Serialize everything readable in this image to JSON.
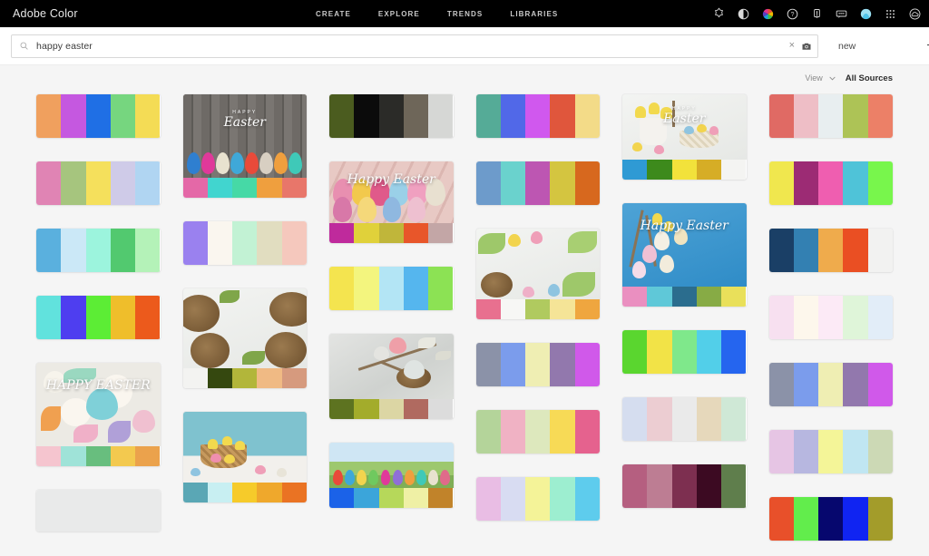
{
  "topbar": {
    "brand": "Adobe Color",
    "nav": [
      {
        "label": "CREATE"
      },
      {
        "label": "EXPLORE"
      },
      {
        "label": "TRENDS"
      },
      {
        "label": "LIBRARIES"
      }
    ],
    "icons": [
      {
        "name": "badge-star-icon"
      },
      {
        "name": "contrast-circle-icon"
      },
      {
        "name": "color-wheel-icon"
      },
      {
        "name": "help-question-icon"
      },
      {
        "name": "notifications-bell-icon"
      },
      {
        "name": "feedback-chat-icon"
      },
      {
        "name": "user-avatar-icon"
      },
      {
        "name": "app-grid-icon"
      },
      {
        "name": "creative-cloud-icon"
      }
    ]
  },
  "search": {
    "value": "happy easter",
    "placeholder": "Search",
    "clear_label": "×",
    "camera_icon": "camera-icon",
    "sort_value": "new",
    "add_label": "+"
  },
  "viewbar": {
    "label": "View",
    "value": "All Sources"
  },
  "grid": {
    "columns": [
      {
        "cards": [
          {
            "type": "palette",
            "name": "color-theme-card",
            "colors": [
              "#f0a05e",
              "#c558e0",
              "#1f6fe5",
              "#76d67f",
              "#f4dc55"
            ]
          },
          {
            "type": "palette",
            "name": "color-theme-card",
            "colors": [
              "#e084b4",
              "#a6c57e",
              "#f5e05c",
              "#cfcbe8",
              "#b0d5f2"
            ]
          },
          {
            "type": "palette",
            "name": "color-theme-card",
            "colors": [
              "#5ab0de",
              "#cbe8f7",
              "#9cf4dd",
              "#52c96f",
              "#b4f2b8"
            ]
          },
          {
            "type": "palette",
            "name": "color-theme-card",
            "colors": [
              "#61e2dd",
              "#4e3ef0",
              "#5ced35",
              "#efbe2b",
              "#ec5a1c"
            ]
          },
          {
            "type": "image",
            "name": "color-theme-card",
            "scene": "cookies",
            "caption": "HAPPY EASTER",
            "colors": [
              "#f5c5cf",
              "#9fe3d8",
              "#68be7e",
              "#f3c94f",
              "#eba24c"
            ]
          },
          {
            "type": "blank",
            "name": "color-theme-card",
            "colors": []
          }
        ]
      },
      {
        "cards": [
          {
            "type": "image",
            "name": "color-theme-card",
            "scene": "wood-eggs",
            "caption": "Easter",
            "caption_small": "HAPPY",
            "colors": [
              "#e468a7",
              "#41d5cf",
              "#46d9a6",
              "#ef9f3e",
              "#e8766a"
            ]
          },
          {
            "type": "palette",
            "name": "color-theme-card",
            "colors": [
              "#9a81ef",
              "#faf6ef",
              "#c2f2d4",
              "#e1ddc0",
              "#f5c8bd"
            ]
          },
          {
            "type": "image",
            "name": "color-theme-card",
            "scene": "nest-wreath",
            "colors": [
              "#f3f3f1",
              "#35480f",
              "#b2b63a",
              "#f0ba84",
              "#d69a7e"
            ]
          },
          {
            "type": "image",
            "name": "color-theme-card",
            "scene": "basket",
            "colors": [
              "#5aa7b5",
              "#c8eff2",
              "#f6cb2a",
              "#efa82c",
              "#ea7323"
            ]
          }
        ]
      },
      {
        "cards": [
          {
            "type": "palette",
            "name": "color-theme-card",
            "colors": [
              "#4b5c1f",
              "#0b0b0b",
              "#2b2b28",
              "#6e6659",
              "#d6d7d5"
            ]
          },
          {
            "type": "image",
            "name": "color-theme-card",
            "scene": "pink-eggs",
            "caption": "Happy Easter",
            "colors": [
              "#bf2a9c",
              "#e0d13a",
              "#c0b63a",
              "#e8562a",
              "#c3a6a6"
            ]
          },
          {
            "type": "palette",
            "name": "color-theme-card",
            "colors": [
              "#f4e44f",
              "#f3f57e",
              "#b3e5f5",
              "#55b6ee",
              "#8ce254"
            ]
          },
          {
            "type": "image",
            "name": "color-theme-card",
            "scene": "stone-nest",
            "colors": [
              "#5d7320",
              "#a3ac2b",
              "#dcd6a4",
              "#b06a60",
              "#dcdcdc"
            ]
          },
          {
            "type": "image",
            "name": "color-theme-card",
            "scene": "spring-eggs",
            "colors": [
              "#1b62e8",
              "#3ba5da",
              "#b6d85a",
              "#eff0a5",
              "#c1832a"
            ]
          }
        ]
      },
      {
        "cards": [
          {
            "type": "palette",
            "name": "color-theme-card",
            "colors": [
              "#55ab97",
              "#5168e8",
              "#d058ee",
              "#e0563c",
              "#f3db88"
            ]
          },
          {
            "type": "palette",
            "name": "color-theme-card",
            "colors": [
              "#6d9bcb",
              "#6ad2cd",
              "#bd56b2",
              "#d4c540",
              "#d7681e"
            ]
          },
          {
            "type": "image",
            "name": "color-theme-card",
            "scene": "white-wreath",
            "colors": [
              "#e8708f",
              "#f7f7f5",
              "#b0ca5f",
              "#f5e497",
              "#efa63f"
            ]
          },
          {
            "type": "palette",
            "name": "color-theme-card",
            "colors": [
              "#8b92a8",
              "#7b9cec",
              "#efeeb3",
              "#9278ad",
              "#d059ea"
            ]
          },
          {
            "type": "palette",
            "name": "color-theme-card",
            "colors": [
              "#b4d49a",
              "#f0b2c4",
              "#dde8bd",
              "#f7da56",
              "#e5628e"
            ]
          },
          {
            "type": "palette",
            "name": "color-theme-card",
            "colors": [
              "#e9bde4",
              "#d8dcf2",
              "#f4f398",
              "#9deed0",
              "#5ecced"
            ]
          }
        ]
      },
      {
        "cards": [
          {
            "type": "image",
            "name": "color-theme-card",
            "scene": "tulip-vase",
            "caption": "Easter",
            "caption_small": "HAPPY",
            "colors": [
              "#2f9ad4",
              "#3d8a1c",
              "#f2e23b",
              "#d6ad26",
              "#f4f4f2"
            ]
          },
          {
            "type": "image",
            "name": "color-theme-card",
            "scene": "blue-eggs",
            "caption": "Happy Easter",
            "colors": [
              "#ea8fc0",
              "#5fc8d8",
              "#2b6d8e",
              "#87ab45",
              "#e9e05a"
            ]
          },
          {
            "type": "palette",
            "name": "color-theme-card",
            "colors": [
              "#5ad62f",
              "#f2e347",
              "#7fe88b",
              "#52cfe9",
              "#2565ef"
            ]
          },
          {
            "type": "palette",
            "name": "color-theme-card",
            "colors": [
              "#d5ddef",
              "#eccdd2",
              "#eaeaea",
              "#e6d8bb",
              "#cfe8d6"
            ]
          },
          {
            "type": "palette",
            "name": "color-theme-card",
            "colors": [
              "#b55f80",
              "#bd7d93",
              "#7d2f50",
              "#3c0a22",
              "#5f7e4c"
            ]
          }
        ]
      },
      {
        "cards": [
          {
            "type": "palette",
            "name": "color-theme-card",
            "colors": [
              "#e06a64",
              "#eebec6",
              "#e8eef0",
              "#adc356",
              "#ec8067"
            ]
          },
          {
            "type": "palette",
            "name": "color-theme-card",
            "colors": [
              "#f0e74e",
              "#9c2b74",
              "#ef5eb0",
              "#4fc3d8",
              "#78f64c"
            ]
          },
          {
            "type": "palette",
            "name": "color-theme-card",
            "colors": [
              "#1a3f66",
              "#3380b2",
              "#efab4c",
              "#ea4f23",
              "#f2f2f1"
            ]
          },
          {
            "type": "palette",
            "name": "color-theme-card",
            "colors": [
              "#f7e0f0",
              "#fdf7ec",
              "#fceaf6",
              "#dff5d9",
              "#e2edf8"
            ]
          },
          {
            "type": "palette",
            "name": "color-theme-card",
            "colors": [
              "#8b92a8",
              "#7b9cec",
              "#efeeb3",
              "#9278ad",
              "#d059ea"
            ]
          },
          {
            "type": "palette",
            "name": "color-theme-card",
            "colors": [
              "#e6c5e4",
              "#b7b7e0",
              "#f4f598",
              "#c0e6f2",
              "#ccd9b5"
            ]
          },
          {
            "type": "palette",
            "name": "color-theme-card",
            "colors": [
              "#e8502a",
              "#62ed4c",
              "#06076e",
              "#1024f2",
              "#a39c2a"
            ]
          }
        ]
      }
    ]
  }
}
